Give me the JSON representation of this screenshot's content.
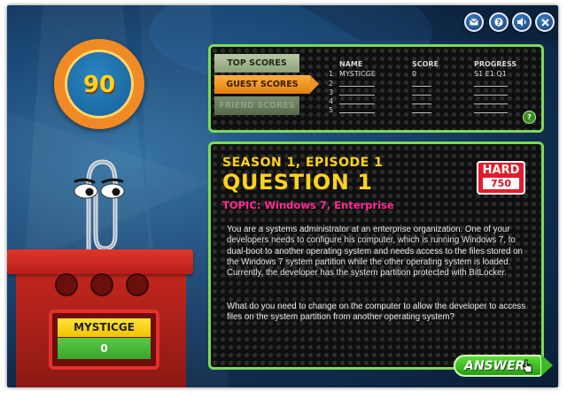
{
  "toolbar": {
    "icons": [
      "mail-icon",
      "help-icon",
      "sound-icon",
      "close-icon"
    ]
  },
  "score": {
    "value": "90"
  },
  "scoreboard": {
    "tabs": {
      "top": "TOP SCORES",
      "guest": "GUEST SCORES",
      "friend": "FRIEND SCORES"
    },
    "active_tab": "GUEST SCORES",
    "headers": {
      "name": "NAME",
      "score": "SCORE",
      "progress": "PROGRESS"
    },
    "rows": [
      {
        "rank": "1",
        "name": "MYSTICGE",
        "score": "0",
        "progress": "S1 E1 Q1"
      },
      {
        "rank": "2",
        "name": "",
        "score": "",
        "progress": ""
      },
      {
        "rank": "3",
        "name": "",
        "score": "",
        "progress": ""
      },
      {
        "rank": "4",
        "name": "",
        "score": "",
        "progress": ""
      },
      {
        "rank": "5",
        "name": "",
        "score": "",
        "progress": ""
      }
    ],
    "help": "?"
  },
  "question": {
    "episode": "SEASON 1, EPISODE 1",
    "title": "QUESTION 1",
    "topic": "TOPIC: Windows 7, Enterprise",
    "difficulty": "HARD",
    "points": "750",
    "paragraph1": "You are a systems administrator at an enterprise organization. One of your developers needs to configure his computer, which is running Windows 7, to dual-boot to another operating system and needs access to the files stored on the Windows 7 system partition while the other operating system is loaded. Currently, the developer has the system partition protected with BitLocker.",
    "paragraph2": "What do you need to change on the computer to allow the developer to access files on the system partition from another operating system?",
    "answer_label": "ANSWER"
  },
  "player": {
    "name": "MYSTICGE",
    "score": "0"
  },
  "colors": {
    "panel_border": "#7ed957",
    "title_yellow": "#ffd21a",
    "topic_pink": "#ff2b95",
    "hard_red": "#e11d2b",
    "podium_red": "#c2261e",
    "score_ring_orange": "#f08a24"
  }
}
